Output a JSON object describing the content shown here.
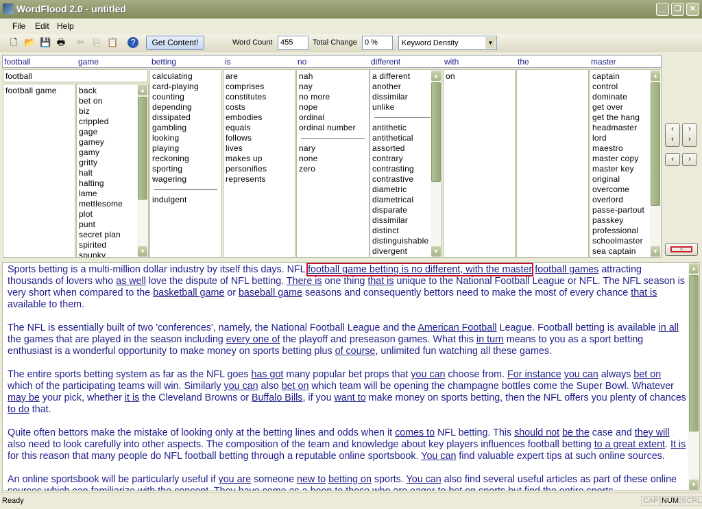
{
  "window": {
    "title": "WordFlood 2.0 - untitled"
  },
  "menu": [
    "File",
    "Edit",
    "Help"
  ],
  "toolbar": {
    "get_content": "Get Content!",
    "word_count_label": "Word Count",
    "word_count": "455",
    "total_change_label": "Total Change",
    "total_change": "0 %",
    "mode": "Keyword Density"
  },
  "header": [
    "football",
    "game",
    "betting",
    "is",
    "no",
    "different",
    "with",
    "the",
    "master"
  ],
  "phrase_input": "football",
  "columns": [
    [
      "football game"
    ],
    [
      "back",
      "bet on",
      "biz",
      "crippled",
      "gage",
      "gamey",
      "gamy",
      "gritty",
      "halt",
      "halting",
      "lame",
      "mettlesome",
      "plot",
      "punt",
      "secret plan",
      "spirited",
      "spunky"
    ],
    [
      "calculating",
      "card-playing",
      "counting",
      "depending",
      "dissipated",
      "gambling",
      "looking",
      "playing",
      "reckoning",
      "sporting",
      "wagering",
      "---",
      "indulgent"
    ],
    [
      "are",
      "comprises",
      "constitutes",
      "costs",
      "embodies",
      "equals",
      "follows",
      "lives",
      "makes up",
      "personifies",
      "represents"
    ],
    [
      "nah",
      "nay",
      "no more",
      "nope",
      "ordinal",
      "ordinal number",
      "---",
      "nary",
      "none",
      "zero"
    ],
    [
      "a different",
      "another",
      "dissimilar",
      "unlike",
      "---",
      "antithetic",
      "antithetical",
      "assorted",
      "contrary",
      "contrasting",
      "contrastive",
      "diametric",
      "diametrical",
      "disparate",
      "dissimilar",
      "distinct",
      "distinguishable",
      "divergent"
    ],
    [
      "on"
    ],
    [],
    [
      "captain",
      "control",
      "dominate",
      "get over",
      "get the hang",
      "headmaster",
      "lord",
      "maestro",
      "master copy",
      "master key",
      "original",
      "overcome",
      "overlord",
      "passe-partout",
      "passkey",
      "professional",
      "schoolmaster",
      "sea captain"
    ]
  ],
  "nav": {
    "prev_all": "< <",
    "next_all": "> >",
    "prev": "<",
    "next": ">"
  },
  "paragraphs": [
    [
      {
        "t": "Sports betting is a multi-million dollar industry by itself this days. NFL "
      },
      {
        "t": "football game betting is no different, with the master",
        "box": true
      },
      {
        "t": " "
      },
      {
        "t": "football games",
        "u": true
      },
      {
        "t": " attracting thousands of lovers who "
      },
      {
        "t": "as well",
        "u": true
      },
      {
        "t": " love the dispute of NFL betting. "
      },
      {
        "t": "There is",
        "u": true
      },
      {
        "t": " one thing "
      },
      {
        "t": "that is",
        "u": true
      },
      {
        "t": " unique to the National Football League or NFL. The NFL season is very short when compared to the "
      },
      {
        "t": "basketball game",
        "u": true
      },
      {
        "t": " or "
      },
      {
        "t": "baseball game",
        "u": true
      },
      {
        "t": " seasons and consequently bettors need to make the most of every chance "
      },
      {
        "t": "that is",
        "u": true
      },
      {
        "t": " available to them."
      }
    ],
    [
      {
        "t": "The NFL is essentially built of two 'conferences', namely, the National Football League and the "
      },
      {
        "t": "American Football",
        "u": true
      },
      {
        "t": " League. Football betting is available "
      },
      {
        "t": "in all",
        "u": true
      },
      {
        "t": " the games that are played in the season including "
      },
      {
        "t": "every one of",
        "u": true
      },
      {
        "t": " the playoff and preseason games. What this "
      },
      {
        "t": "in turn",
        "u": true
      },
      {
        "t": " means to you as a sport betting enthusiast is a wonderful opportunity to make money on sports betting plus "
      },
      {
        "t": "of course",
        "u": true
      },
      {
        "t": ", unlimited fun watching all these games."
      }
    ],
    [
      {
        "t": "The entire sports betting system as far as the NFL goes "
      },
      {
        "t": "has got",
        "u": true
      },
      {
        "t": " many popular bet props that "
      },
      {
        "t": "you can",
        "u": true
      },
      {
        "t": " choose from. "
      },
      {
        "t": "For instance",
        "u": true
      },
      {
        "t": " "
      },
      {
        "t": "you can",
        "u": true
      },
      {
        "t": " always "
      },
      {
        "t": "bet on",
        "u": true
      },
      {
        "t": " which of the participating teams will win. Similarly "
      },
      {
        "t": "you can",
        "u": true
      },
      {
        "t": " also "
      },
      {
        "t": "bet on",
        "u": true
      },
      {
        "t": " which team will be opening the champagne bottles come the Super Bowl. Whatever "
      },
      {
        "t": "may be",
        "u": true
      },
      {
        "t": " your pick, whether "
      },
      {
        "t": "it is",
        "u": true
      },
      {
        "t": " the Cleveland Browns or "
      },
      {
        "t": "Buffalo Bills",
        "u": true
      },
      {
        "t": ", if you "
      },
      {
        "t": "want to",
        "u": true
      },
      {
        "t": " make money on sports betting, then the NFL offers you plenty of chances "
      },
      {
        "t": "to do",
        "u": true
      },
      {
        "t": " that."
      }
    ],
    [
      {
        "t": "Quite often bettors make the mistake of looking only at the betting lines and odds when it "
      },
      {
        "t": "comes to",
        "u": true
      },
      {
        "t": " NFL betting. This "
      },
      {
        "t": "should not",
        "u": true
      },
      {
        "t": " "
      },
      {
        "t": "be the",
        "u": true
      },
      {
        "t": " case and "
      },
      {
        "t": "they will",
        "u": true
      },
      {
        "t": " also need to look carefully into other aspects. The composition of the team and knowledge about key players influences football betting "
      },
      {
        "t": "to a great extent",
        "u": true
      },
      {
        "t": ". "
      },
      {
        "t": "It is",
        "u": true
      },
      {
        "t": " for this reason that many people do NFL football betting through a reputable online sportsbook. "
      },
      {
        "t": "You can",
        "u": true
      },
      {
        "t": " find valuable expert tips at such online sources."
      }
    ],
    [
      {
        "t": "An online sportsbook will be particularly useful if "
      },
      {
        "t": "you are",
        "u": true
      },
      {
        "t": " someone "
      },
      {
        "t": "new to",
        "u": true
      },
      {
        "t": " "
      },
      {
        "t": "betting on",
        "u": true
      },
      {
        "t": " sports. "
      },
      {
        "t": "You can",
        "u": true
      },
      {
        "t": " also find several useful articles as part of these online sources which can familiarize with the concept. They have come as a boon to those who are eager to bet on sports but find the entire sports"
      }
    ]
  ],
  "status": {
    "text": "Ready",
    "cap": "CAP",
    "num": "NUM",
    "scrl": "SCRL"
  },
  "colors": {
    "title_bar": "#8e9868",
    "text": "#1c1c8a",
    "highlight_box": "#c8102e"
  }
}
